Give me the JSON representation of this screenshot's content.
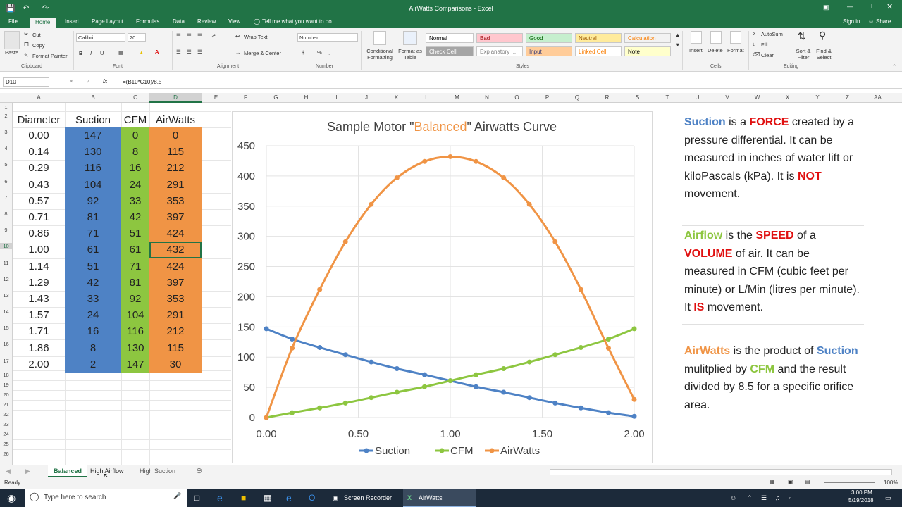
{
  "window": {
    "title": "AirWatts Comparisons - Excel",
    "signin": "Sign in",
    "share": "Share"
  },
  "ribbon_tabs": [
    "File",
    "Home",
    "Insert",
    "Page Layout",
    "Formulas",
    "Data",
    "Review",
    "View"
  ],
  "tell_me": "Tell me what you want to do...",
  "ribbon": {
    "clipboard": {
      "paste": "Paste",
      "cut": "Cut",
      "copy": "Copy",
      "format_painter": "Format Painter",
      "label": "Clipboard"
    },
    "font": {
      "name": "Calibri",
      "size": "20",
      "label": "Font",
      "bold": "B",
      "italic": "I",
      "underline": "U"
    },
    "alignment": {
      "wrap": "Wrap Text",
      "merge": "Merge & Center",
      "label": "Alignment"
    },
    "number": {
      "format": "Number",
      "currency": "$",
      "percent": "%",
      "comma": ",",
      "label": "Number"
    },
    "styles": {
      "conditional": "Conditional Formatting",
      "format_table": "Format as Table",
      "cell_styles": [
        {
          "name": "Normal",
          "bg": "#ffffff",
          "fg": "#000000"
        },
        {
          "name": "Bad",
          "bg": "#ffc7ce",
          "fg": "#9c0006"
        },
        {
          "name": "Good",
          "bg": "#c6efce",
          "fg": "#006100"
        },
        {
          "name": "Neutral",
          "bg": "#ffeb9c",
          "fg": "#9c5700"
        },
        {
          "name": "Calculation",
          "bg": "#f2f2f2",
          "fg": "#fa7d00"
        },
        {
          "name": "Check Cell",
          "bg": "#a5a5a5",
          "fg": "#ffffff"
        },
        {
          "name": "Explanatory ...",
          "bg": "#ffffff",
          "fg": "#7f7f7f"
        },
        {
          "name": "Input",
          "bg": "#ffcc99",
          "fg": "#3f3f76"
        },
        {
          "name": "Linked Cell",
          "bg": "#ffffff",
          "fg": "#fa7d00"
        },
        {
          "name": "Note",
          "bg": "#ffffcc",
          "fg": "#000000"
        }
      ],
      "label": "Styles"
    },
    "cells": {
      "insert": "Insert",
      "delete": "Delete",
      "format": "Format",
      "label": "Cells"
    },
    "editing": {
      "autosum": "AutoSum",
      "fill": "Fill",
      "clear": "Clear",
      "sort": "Sort & Filter",
      "find": "Find & Select",
      "label": "Editing"
    }
  },
  "formula_bar": {
    "name_box": "D10",
    "formula": "=(B10*C10)/8.5",
    "fx": "fx"
  },
  "columns": [
    "A",
    "B",
    "C",
    "D",
    "E",
    "F",
    "G",
    "H",
    "I",
    "J",
    "K",
    "L",
    "M",
    "N",
    "O",
    "P",
    "Q",
    "R",
    "S",
    "T",
    "U",
    "V",
    "W",
    "X",
    "Y",
    "Z",
    "AA"
  ],
  "rows": [
    "1",
    "2",
    "3",
    "4",
    "5",
    "6",
    "7",
    "8",
    "9",
    "10",
    "11",
    "12",
    "13",
    "14",
    "15",
    "16",
    "17",
    "18",
    "19",
    "20",
    "21",
    "22",
    "23",
    "24",
    "25",
    "26"
  ],
  "table": {
    "headers": [
      "Diameter",
      "Suction",
      "CFM",
      "AirWatts"
    ],
    "diameter": [
      "0.00",
      "0.14",
      "0.29",
      "0.43",
      "0.57",
      "0.71",
      "0.86",
      "1.00",
      "1.14",
      "1.29",
      "1.43",
      "1.57",
      "1.71",
      "1.86",
      "2.00"
    ],
    "suction": [
      "147",
      "130",
      "116",
      "104",
      "92",
      "81",
      "71",
      "61",
      "51",
      "42",
      "33",
      "24",
      "16",
      "8",
      "2"
    ],
    "cfm": [
      "0",
      "8",
      "16",
      "24",
      "33",
      "42",
      "51",
      "61",
      "71",
      "81",
      "92",
      "104",
      "116",
      "130",
      "147"
    ],
    "airwatts": [
      "0",
      "115",
      "212",
      "291",
      "353",
      "397",
      "424",
      "432",
      "424",
      "397",
      "353",
      "291",
      "212",
      "115",
      "30"
    ],
    "colors": {
      "suction": "#4e82c5",
      "cfm": "#8dc640",
      "airwatts": "#f09445"
    }
  },
  "chart_data": {
    "type": "scatter",
    "title_parts": [
      "Sample Motor \"",
      "Balanced",
      "\" Airwatts Curve"
    ],
    "x": [
      0.0,
      0.14,
      0.29,
      0.43,
      0.57,
      0.71,
      0.86,
      1.0,
      1.14,
      1.29,
      1.43,
      1.57,
      1.71,
      1.86,
      2.0
    ],
    "series": [
      {
        "name": "Suction",
        "color": "#4e82c5",
        "values": [
          147,
          130,
          116,
          104,
          92,
          81,
          71,
          61,
          51,
          42,
          33,
          24,
          16,
          8,
          2
        ]
      },
      {
        "name": "CFM",
        "color": "#8dc640",
        "values": [
          0,
          8,
          16,
          24,
          33,
          42,
          51,
          61,
          71,
          81,
          92,
          104,
          116,
          130,
          147
        ]
      },
      {
        "name": "AirWatts",
        "color": "#f09445",
        "values": [
          0,
          115,
          212,
          291,
          353,
          397,
          424,
          432,
          424,
          397,
          353,
          291,
          212,
          115,
          30
        ]
      }
    ],
    "xlim": [
      0,
      2
    ],
    "ylim": [
      0,
      450
    ],
    "xticks": [
      "0.00",
      "0.50",
      "1.00",
      "1.50",
      "2.00"
    ],
    "yticks": [
      "0",
      "50",
      "100",
      "150",
      "200",
      "250",
      "300",
      "350",
      "400",
      "450"
    ],
    "legend": "bottom",
    "grid": true
  },
  "notes": {
    "p1": [
      "Suction",
      " is a ",
      "FORCE",
      " created by a pressure differential. It can be measured in inches of water lift or kiloPascals (kPa). It is ",
      "NOT",
      " movement."
    ],
    "p2": [
      "Airflow",
      " is the ",
      "SPEED",
      " of a ",
      "VOLUME",
      " of air. It can be measured in CFM (cubic feet per minute) or L/Min (litres per minute). It ",
      "IS",
      " movement."
    ],
    "p3": [
      "AirWatts",
      " is the product of ",
      "Suction",
      " mulitplied by ",
      "CFM",
      " and the result divided by 8.5 for a specific orifice area."
    ]
  },
  "sheet_tabs": [
    "Balanced",
    "High Airflow",
    "High Suction"
  ],
  "status": {
    "ready": "Ready",
    "zoom": "100%"
  },
  "taskbar": {
    "search": "Type here to search",
    "apps": [
      "Screen Recorder",
      "AirWatts Comparis..."
    ],
    "time": "3:00 PM",
    "date": "5/19/2018"
  }
}
